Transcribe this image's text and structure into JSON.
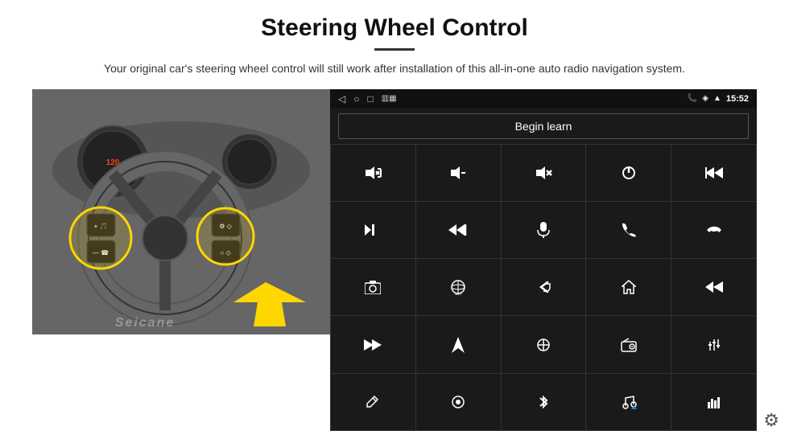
{
  "header": {
    "title": "Steering Wheel Control",
    "subtitle": "Your original car's steering wheel control will still work after installation of this all-in-one auto radio navigation system."
  },
  "status_bar": {
    "time": "15:52",
    "icons_left": [
      "back-icon",
      "home-icon",
      "recents-icon",
      "signal-icon"
    ],
    "icons_right": [
      "phone-icon",
      "wifi-icon",
      "signal-bars-icon",
      "time-label"
    ]
  },
  "begin_learn": {
    "label": "Begin learn"
  },
  "control_buttons": [
    {
      "icon": "🔊+",
      "label": "vol-up"
    },
    {
      "icon": "🔊—",
      "label": "vol-down"
    },
    {
      "icon": "🔇",
      "label": "mute"
    },
    {
      "icon": "⏻",
      "label": "power"
    },
    {
      "icon": "⏮",
      "label": "prev-track"
    },
    {
      "icon": "⏭",
      "label": "next"
    },
    {
      "icon": "⏭✂",
      "label": "next2"
    },
    {
      "icon": "🎤",
      "label": "mic"
    },
    {
      "icon": "📞",
      "label": "call"
    },
    {
      "icon": "📵",
      "label": "end-call"
    },
    {
      "icon": "📷",
      "label": "camera"
    },
    {
      "icon": "👁360",
      "label": "360-view"
    },
    {
      "icon": "↩",
      "label": "back"
    },
    {
      "icon": "🏠",
      "label": "home"
    },
    {
      "icon": "⏮⏮",
      "label": "rewind"
    },
    {
      "icon": "⏭⏭",
      "label": "fast-forward"
    },
    {
      "icon": "🧭",
      "label": "nav"
    },
    {
      "icon": "🔄",
      "label": "swap"
    },
    {
      "icon": "📻",
      "label": "radio"
    },
    {
      "icon": "🎚",
      "label": "eq"
    },
    {
      "icon": "✏",
      "label": "edit"
    },
    {
      "icon": "⭕",
      "label": "circle"
    },
    {
      "icon": "🔵",
      "label": "bt"
    },
    {
      "icon": "🎵",
      "label": "music"
    },
    {
      "icon": "📊",
      "label": "equalizer"
    }
  ],
  "watermark": "Seicane",
  "gear_icon": "⚙"
}
